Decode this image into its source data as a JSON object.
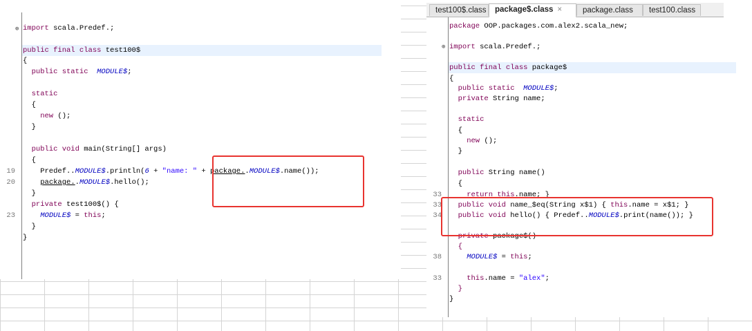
{
  "left_editor": {
    "lines": [
      {
        "segments": [
          {
            "t": "import",
            "c": "kw"
          },
          {
            "t": " scala.Predef.;",
            "c": ""
          }
        ]
      },
      {
        "segments": [
          {
            "t": "public final class",
            "c": "kw"
          },
          {
            "t": " test100$",
            "c": ""
          }
        ]
      },
      {
        "segments": [
          {
            "t": "{",
            "c": ""
          }
        ]
      },
      {
        "segments": [
          {
            "t": "  public static",
            "c": "kw"
          },
          {
            "t": "  ",
            "c": ""
          },
          {
            "t": "MODULE$",
            "c": "it"
          },
          {
            "t": ";",
            "c": ""
          }
        ]
      },
      {
        "segments": [
          {
            "t": "  static",
            "c": "kw"
          }
        ]
      },
      {
        "segments": [
          {
            "t": "  {",
            "c": ""
          }
        ]
      },
      {
        "segments": [
          {
            "t": "    new",
            "c": "kw"
          },
          {
            "t": " ();",
            "c": ""
          }
        ]
      },
      {
        "segments": [
          {
            "t": "  }",
            "c": ""
          }
        ]
      },
      {
        "segments": [
          {
            "t": "  public void",
            "c": "kw"
          },
          {
            "t": " main(String[] args)",
            "c": ""
          }
        ]
      },
      {
        "segments": [
          {
            "t": "  {",
            "c": ""
          }
        ]
      },
      {
        "segments": [
          {
            "t": "    Predef..",
            "c": ""
          },
          {
            "t": "MODULE$",
            "c": "it"
          },
          {
            "t": ".println(",
            "c": ""
          },
          {
            "t": "6",
            "c": "it"
          },
          {
            "t": " + ",
            "c": ""
          },
          {
            "t": "\"name: \"",
            "c": "str"
          },
          {
            "t": " + ",
            "c": ""
          },
          {
            "t": "package.",
            "c": "ul"
          },
          {
            "t": ".",
            "c": ""
          },
          {
            "t": "MODULE$",
            "c": "it"
          },
          {
            "t": ".name());",
            "c": ""
          }
        ]
      },
      {
        "segments": [
          {
            "t": "    ",
            "c": ""
          },
          {
            "t": "package.",
            "c": "ul"
          },
          {
            "t": ".",
            "c": ""
          },
          {
            "t": "MODULE$",
            "c": "it"
          },
          {
            "t": ".hello();",
            "c": ""
          }
        ]
      },
      {
        "segments": [
          {
            "t": "  }",
            "c": ""
          }
        ]
      },
      {
        "segments": [
          {
            "t": "  private",
            "c": "kw"
          },
          {
            "t": " test100$() {",
            "c": ""
          }
        ]
      },
      {
        "segments": [
          {
            "t": "    ",
            "c": ""
          },
          {
            "t": "MODULE$",
            "c": "it"
          },
          {
            "t": " = ",
            "c": ""
          },
          {
            "t": "this",
            "c": "kw"
          },
          {
            "t": ";",
            "c": ""
          }
        ]
      },
      {
        "segments": [
          {
            "t": "  }",
            "c": ""
          }
        ]
      },
      {
        "segments": [
          {
            "t": "}",
            "c": ""
          }
        ]
      }
    ],
    "line_numbers": [
      {
        "n": "19",
        "row": 10
      },
      {
        "n": "20",
        "row": 11
      },
      {
        "n": "23",
        "row": 14
      }
    ]
  },
  "right_editor": {
    "tabs": [
      {
        "label": "test100$.class",
        "active": false
      },
      {
        "label": "package$.class",
        "active": true,
        "close": "×"
      },
      {
        "label": "package.class",
        "active": false
      },
      {
        "label": "test100.class",
        "active": false
      }
    ],
    "lines": [
      {
        "segments": [
          {
            "t": "package",
            "c": "kw"
          },
          {
            "t": " OOP.packages.com.alex2.scala_new;",
            "c": ""
          }
        ]
      },
      {
        "segments": [
          {
            "t": "import",
            "c": "kw"
          },
          {
            "t": " scala.Predef.;",
            "c": ""
          }
        ]
      },
      {
        "segments": [
          {
            "t": "public final class",
            "c": "kw"
          },
          {
            "t": " package$",
            "c": ""
          }
        ]
      },
      {
        "segments": [
          {
            "t": "{",
            "c": ""
          }
        ]
      },
      {
        "segments": [
          {
            "t": "  public static",
            "c": "kw"
          },
          {
            "t": "  ",
            "c": ""
          },
          {
            "t": "MODULE$",
            "c": "it"
          },
          {
            "t": ";",
            "c": ""
          }
        ]
      },
      {
        "segments": [
          {
            "t": "  private",
            "c": "kw"
          },
          {
            "t": " String name;",
            "c": ""
          }
        ]
      },
      {
        "segments": [
          {
            "t": "  static",
            "c": "kw"
          }
        ]
      },
      {
        "segments": [
          {
            "t": "  {",
            "c": ""
          }
        ]
      },
      {
        "segments": [
          {
            "t": "    new",
            "c": "kw"
          },
          {
            "t": " ();",
            "c": ""
          }
        ]
      },
      {
        "segments": [
          {
            "t": "  }",
            "c": ""
          }
        ]
      },
      {
        "segments": [
          {
            "t": "  public",
            "c": "kw"
          },
          {
            "t": " String name()",
            "c": ""
          }
        ]
      },
      {
        "segments": [
          {
            "t": "  {",
            "c": ""
          }
        ]
      },
      {
        "segments": [
          {
            "t": "    return this",
            "c": "kw"
          },
          {
            "t": ".name; }",
            "c": ""
          }
        ]
      },
      {
        "segments": [
          {
            "t": "  public void",
            "c": "kw"
          },
          {
            "t": " name_$eq(String x$1) { ",
            "c": ""
          },
          {
            "t": "this",
            "c": "kw"
          },
          {
            "t": ".name = x$1; }",
            "c": ""
          }
        ]
      },
      {
        "segments": [
          {
            "t": "  public void",
            "c": "kw"
          },
          {
            "t": " hello() { Predef..",
            "c": ""
          },
          {
            "t": "MODULE$",
            "c": "it"
          },
          {
            "t": ".print(name()); }",
            "c": ""
          }
        ]
      },
      {
        "segments": [
          {
            "t": "  private",
            "c": "kw"
          },
          {
            "t": " package$()",
            "c": ""
          }
        ]
      },
      {
        "segments": [
          {
            "t": "  {",
            "c": "kw"
          }
        ]
      },
      {
        "segments": [
          {
            "t": "    ",
            "c": ""
          },
          {
            "t": "MODULE$",
            "c": "it"
          },
          {
            "t": " = ",
            "c": ""
          },
          {
            "t": "this",
            "c": "kw"
          },
          {
            "t": ";",
            "c": ""
          }
        ]
      },
      {
        "segments": [
          {
            "t": "    this",
            "c": "kw"
          },
          {
            "t": ".name = ",
            "c": ""
          },
          {
            "t": "\"alex\"",
            "c": "str"
          },
          {
            "t": ";",
            "c": ""
          }
        ]
      },
      {
        "segments": [
          {
            "t": "  }",
            "c": "kw"
          }
        ]
      },
      {
        "segments": [
          {
            "t": "}",
            "c": ""
          }
        ]
      }
    ],
    "line_numbers": [
      {
        "n": "33",
        "row": 12
      },
      {
        "n": "33",
        "row": 13
      },
      {
        "n": "34",
        "row": 14
      },
      {
        "n": "38",
        "row": 17
      },
      {
        "n": "33",
        "row": 18
      }
    ]
  },
  "colors": {
    "keyword": "#7f0055",
    "static_field": "#0000c0",
    "string": "#2a00ff",
    "highlight": "#e8f2fe",
    "annotation_box": "#e8332f"
  }
}
